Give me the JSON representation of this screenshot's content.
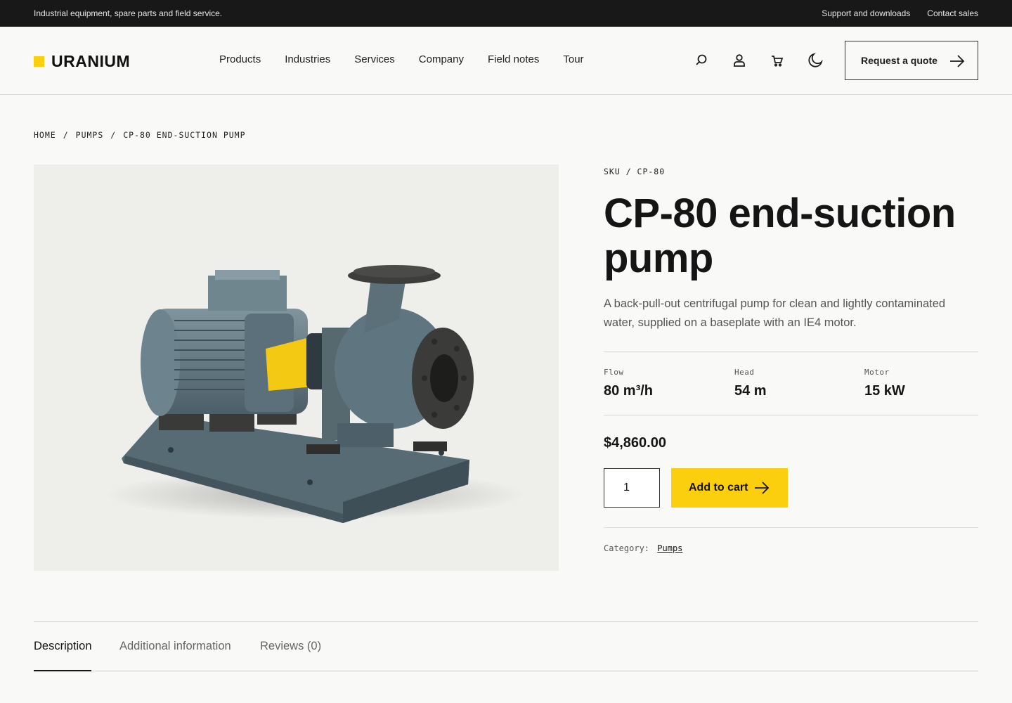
{
  "colors": {
    "accent": "#fbcf0e",
    "dark": "#181818",
    "pump_body": "#5f7580"
  },
  "topbar": {
    "tagline": "Industrial equipment, spare parts and field service.",
    "links": [
      "Support and downloads",
      "Contact sales"
    ]
  },
  "header": {
    "logo": "URANIUM",
    "nav": [
      "Products",
      "Industries",
      "Services",
      "Company",
      "Field notes",
      "Tour"
    ],
    "icons": [
      "search-icon",
      "account-icon",
      "cart-icon",
      "moon-icon"
    ],
    "quote_button": "Request a quote"
  },
  "breadcrumb": [
    "HOME",
    "PUMPS",
    "CP-80 END-SUCTION PUMP"
  ],
  "product": {
    "sku": "SKU / CP-80",
    "title": "CP-80 end-suction pump",
    "description": "A back-pull-out centrifugal pump for clean and lightly contaminated water, supplied on a baseplate with an IE4 motor.",
    "specs": [
      {
        "label": "Flow",
        "value": "80 m³/h"
      },
      {
        "label": "Head",
        "value": "54 m"
      },
      {
        "label": "Motor",
        "value": "15 kW"
      }
    ],
    "price": "$4,860.00",
    "quantity": "1",
    "add_to_cart": "Add to cart",
    "category_label": "Category:",
    "category": "Pumps"
  },
  "tabs": [
    "Description",
    "Additional information",
    "Reviews (0)"
  ]
}
